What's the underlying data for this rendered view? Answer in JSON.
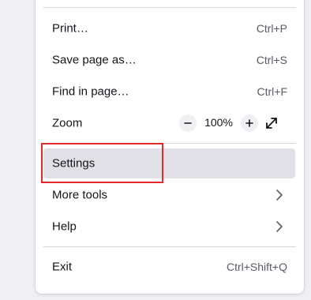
{
  "menu": {
    "items": [
      {
        "label": "Print…",
        "shortcut": "Ctrl+P"
      },
      {
        "label": "Save page as…",
        "shortcut": "Ctrl+S"
      },
      {
        "label": "Find in page…",
        "shortcut": "Ctrl+F"
      }
    ],
    "zoom": {
      "label": "Zoom",
      "value": "100%",
      "minus_glyph": "−",
      "plus_glyph": "+"
    },
    "settings": {
      "label": "Settings"
    },
    "more_tools": {
      "label": "More tools"
    },
    "help": {
      "label": "Help"
    },
    "exit": {
      "label": "Exit",
      "shortcut": "Ctrl+Shift+Q"
    }
  },
  "colors": {
    "highlight": "#e32929",
    "active_row": "#e0e0e6"
  },
  "icons": [
    "zoom-out-icon",
    "zoom-in-icon",
    "fullscreen-icon",
    "chevron-right-icon"
  ]
}
